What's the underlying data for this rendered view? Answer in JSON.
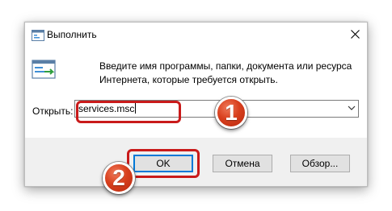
{
  "window": {
    "title": "Выполнить",
    "icon": "run-app-icon",
    "close_symbol": "✕"
  },
  "dialog": {
    "description_line1": "Введите имя программы, папки, документа или ресурса",
    "description_line2": "Интернета, которые требуется открыть.",
    "open_label": "Открыть:",
    "input_value": "services.msc"
  },
  "buttons": {
    "ok": "OK",
    "cancel": "Отмена",
    "browse": "Обзор..."
  },
  "annotations": {
    "step1": "1",
    "step2": "2",
    "highlight_color": "#c91a1a",
    "badge_color": "#d8401e"
  },
  "colors": {
    "footer_bg": "#f0f0f0",
    "button_bg": "#e1e1e1",
    "default_button_border": "#0078d7"
  }
}
